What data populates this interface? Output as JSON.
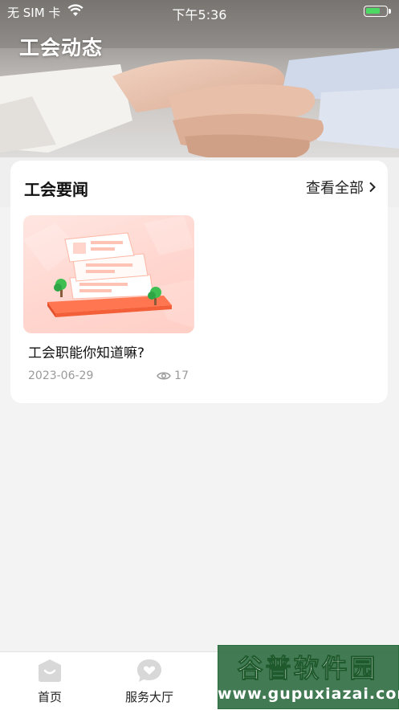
{
  "status_bar": {
    "carrier": "无 SIM 卡",
    "time": "下午5:36",
    "battery_level": 0.7,
    "battery_color": "#4cd964"
  },
  "header": {
    "title": "工会动态"
  },
  "news_section": {
    "title": "工会要闻",
    "view_all_label": "查看全部",
    "items": [
      {
        "title": "工会职能你知道嘛?",
        "date": "2023-06-29",
        "views": "17",
        "thumbnail_icon": "news-illustration-icon"
      }
    ]
  },
  "tab_bar": {
    "tabs": [
      {
        "label": "首页",
        "icon": "home-icon",
        "active": true
      },
      {
        "label": "服务大厅",
        "icon": "heart-chat-icon",
        "active": false
      }
    ]
  },
  "watermark": {
    "title": "谷普软件园",
    "url": "www.gupuxiazai.com"
  },
  "colors": {
    "accent": "#ff6a45",
    "tab_icon": "#d8d8d8",
    "watermark": "#347046"
  }
}
